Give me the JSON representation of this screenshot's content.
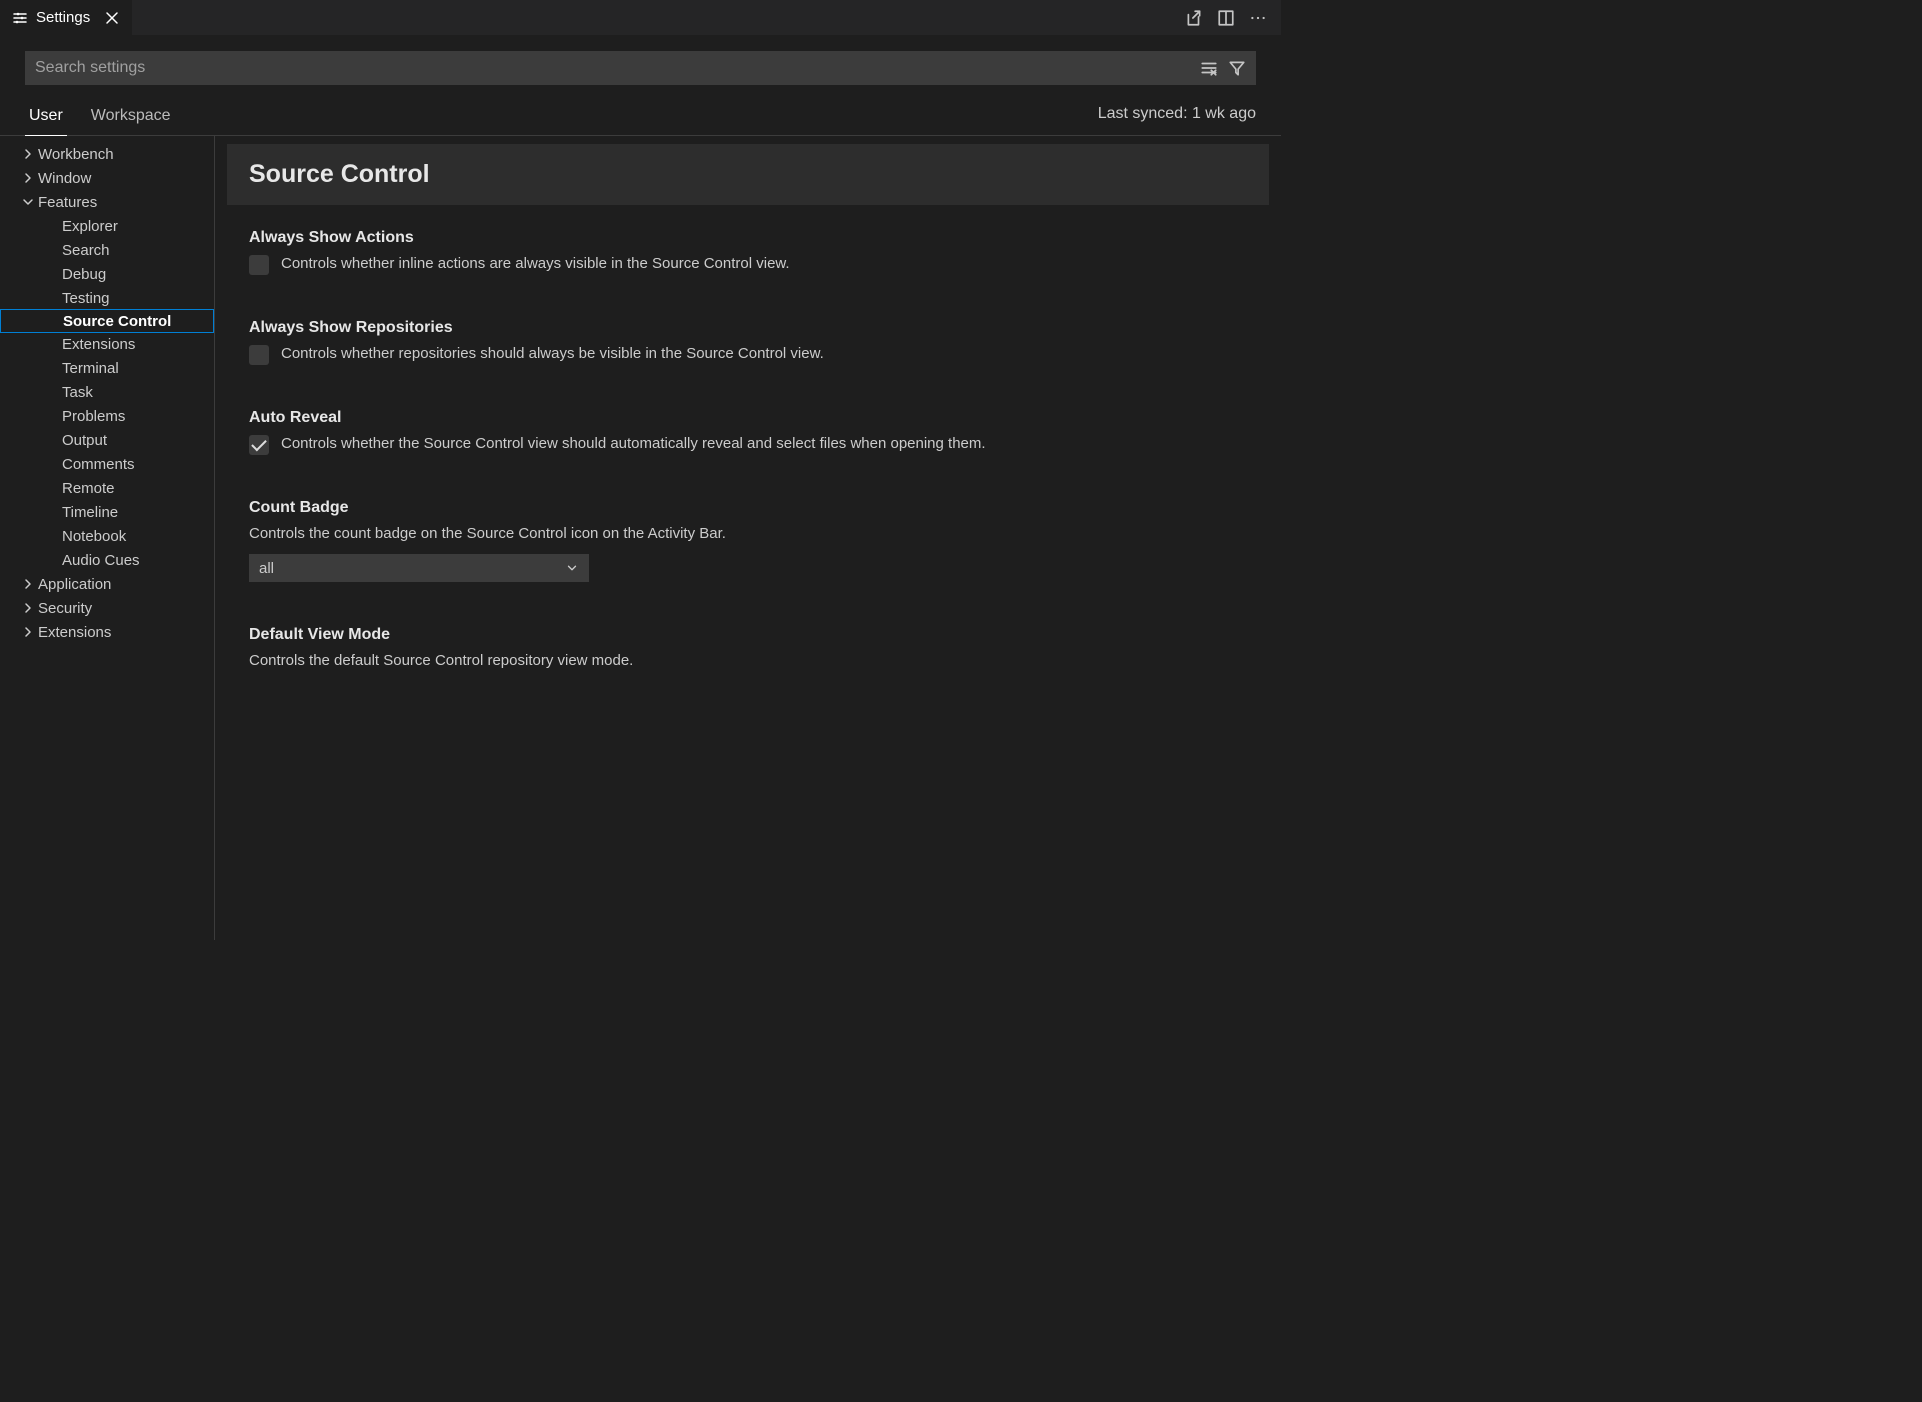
{
  "tab": {
    "title": "Settings"
  },
  "search": {
    "placeholder": "Search settings"
  },
  "scope": {
    "user": "User",
    "workspace": "Workspace",
    "lastSynced": "Last synced: 1 wk ago"
  },
  "sidebar": {
    "items": [
      {
        "label": "Workbench",
        "twisty": ">",
        "indent": "top"
      },
      {
        "label": "Window",
        "twisty": ">",
        "indent": "top"
      },
      {
        "label": "Features",
        "twisty": "v",
        "indent": "top"
      },
      {
        "label": "Explorer",
        "indent": 1
      },
      {
        "label": "Search",
        "indent": 1
      },
      {
        "label": "Debug",
        "indent": 1
      },
      {
        "label": "Testing",
        "indent": 1
      },
      {
        "label": "Source Control",
        "indent": 1,
        "selected": true
      },
      {
        "label": "Extensions",
        "indent": 1
      },
      {
        "label": "Terminal",
        "indent": 1
      },
      {
        "label": "Task",
        "indent": 1
      },
      {
        "label": "Problems",
        "indent": 1
      },
      {
        "label": "Output",
        "indent": 1
      },
      {
        "label": "Comments",
        "indent": 1
      },
      {
        "label": "Remote",
        "indent": 1
      },
      {
        "label": "Timeline",
        "indent": 1
      },
      {
        "label": "Notebook",
        "indent": 1
      },
      {
        "label": "Audio Cues",
        "indent": 1
      },
      {
        "label": "Application",
        "twisty": ">",
        "indent": "top"
      },
      {
        "label": "Security",
        "twisty": ">",
        "indent": "top"
      },
      {
        "label": "Extensions",
        "twisty": ">",
        "indent": "top"
      }
    ]
  },
  "section": {
    "title": "Source Control"
  },
  "settings": {
    "alwaysShowActions": {
      "title": "Always Show Actions",
      "desc": "Controls whether inline actions are always visible in the Source Control view.",
      "checked": false
    },
    "alwaysShowRepositories": {
      "title": "Always Show Repositories",
      "desc": "Controls whether repositories should always be visible in the Source Control view.",
      "checked": false
    },
    "autoReveal": {
      "title": "Auto Reveal",
      "desc": "Controls whether the Source Control view should automatically reveal and select files when opening them.",
      "checked": true
    },
    "countBadge": {
      "title": "Count Badge",
      "desc": "Controls the count badge on the Source Control icon on the Activity Bar.",
      "value": "all"
    },
    "defaultViewMode": {
      "title": "Default View Mode",
      "desc": "Controls the default Source Control repository view mode."
    }
  }
}
